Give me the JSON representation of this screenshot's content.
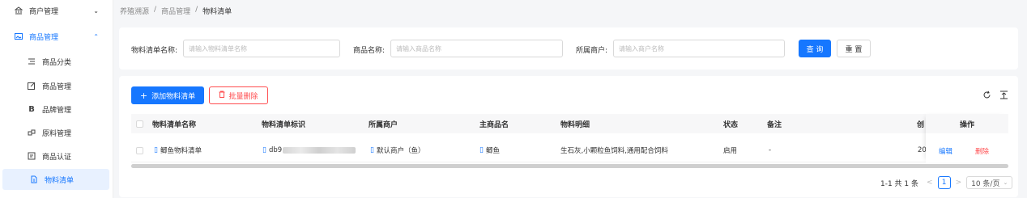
{
  "sidebar": {
    "items": [
      {
        "label": "商户管理",
        "icon": "bank-icon",
        "chevron": "⌄"
      },
      {
        "label": "商品管理",
        "icon": "image-icon",
        "chevron": "⌃"
      },
      {
        "label": "商品分类",
        "icon": "list-icon"
      },
      {
        "label": "商品管理",
        "icon": "edit-icon"
      },
      {
        "label": "品牌管理",
        "icon": "brand-icon"
      },
      {
        "label": "原料管理",
        "icon": "material-icon"
      },
      {
        "label": "商品认证",
        "icon": "certificate-icon"
      },
      {
        "label": "物料清单",
        "icon": "document-icon"
      }
    ]
  },
  "breadcrumb": [
    "养殖溯源",
    "/",
    "商品管理",
    "/",
    "物料清单"
  ],
  "search": {
    "bom_name_label": "物料清单名称:",
    "bom_name_placeholder": "请输入物料清单名称",
    "product_name_label": "商品名称:",
    "product_name_placeholder": "请输入商品名称",
    "merchant_label": "所属商户:",
    "merchant_placeholder": "请输入商户名称",
    "query_label": "查 询",
    "reset_label": "重 置"
  },
  "toolbar": {
    "add_label": "添加物料清单",
    "batch_delete_label": "批量删除"
  },
  "table": {
    "columns": [
      "物料清单名称",
      "物料清单标识",
      "所属商户",
      "主商品名",
      "物料明细",
      "状态",
      "备注",
      "创",
      "操作"
    ],
    "rows": [
      {
        "name": "鲫鱼物料清单",
        "id_prefix": "db9",
        "merchant": "默认商户（鱼）",
        "main_product": "鲫鱼",
        "detail": "生石灰,小颗粒鱼饲料,通用配合饲料",
        "status": "启用",
        "remark": "-",
        "created": "20",
        "edit": "编辑",
        "delete": "删除"
      }
    ]
  },
  "pagination": {
    "summary": "1-1 共 1 条",
    "prev": "<",
    "page": "1",
    "next": ">",
    "page_size": "10 条/页"
  },
  "colors": {
    "primary": "#1677ff",
    "danger": "#ff4d4f"
  }
}
